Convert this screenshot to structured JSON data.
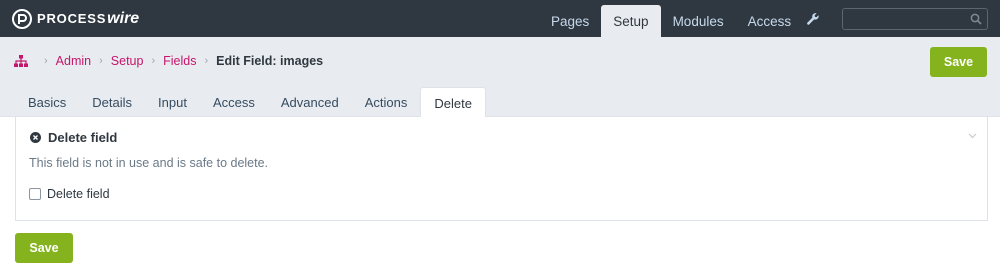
{
  "brand": {
    "name_part1": "PROCESS",
    "name_part2": "wire"
  },
  "nav": {
    "items": [
      {
        "label": "Pages"
      },
      {
        "label": "Setup",
        "active": true
      },
      {
        "label": "Modules"
      },
      {
        "label": "Access"
      }
    ],
    "tools_icon": "wrench-icon"
  },
  "search": {
    "value": "",
    "placeholder": "",
    "icon": "search-icon"
  },
  "breadcrumb": {
    "home_icon": "sitemap-icon",
    "links": [
      "Admin",
      "Setup",
      "Fields"
    ],
    "current": "Edit Field: images"
  },
  "actions": {
    "save_label": "Save"
  },
  "tabs": [
    {
      "label": "Basics"
    },
    {
      "label": "Details"
    },
    {
      "label": "Input"
    },
    {
      "label": "Access"
    },
    {
      "label": "Advanced"
    },
    {
      "label": "Actions"
    },
    {
      "label": "Delete",
      "active": true
    }
  ],
  "delete_panel": {
    "title": "Delete field",
    "title_icon": "times-circle-icon",
    "description": "This field is not in use and is safe to delete.",
    "checkbox_label": "Delete field",
    "checked": false
  },
  "colors": {
    "topbar": "#2f3840",
    "accent_link": "#c4166b",
    "save_button": "#85b31e",
    "header_band": "#e8ecf0"
  }
}
